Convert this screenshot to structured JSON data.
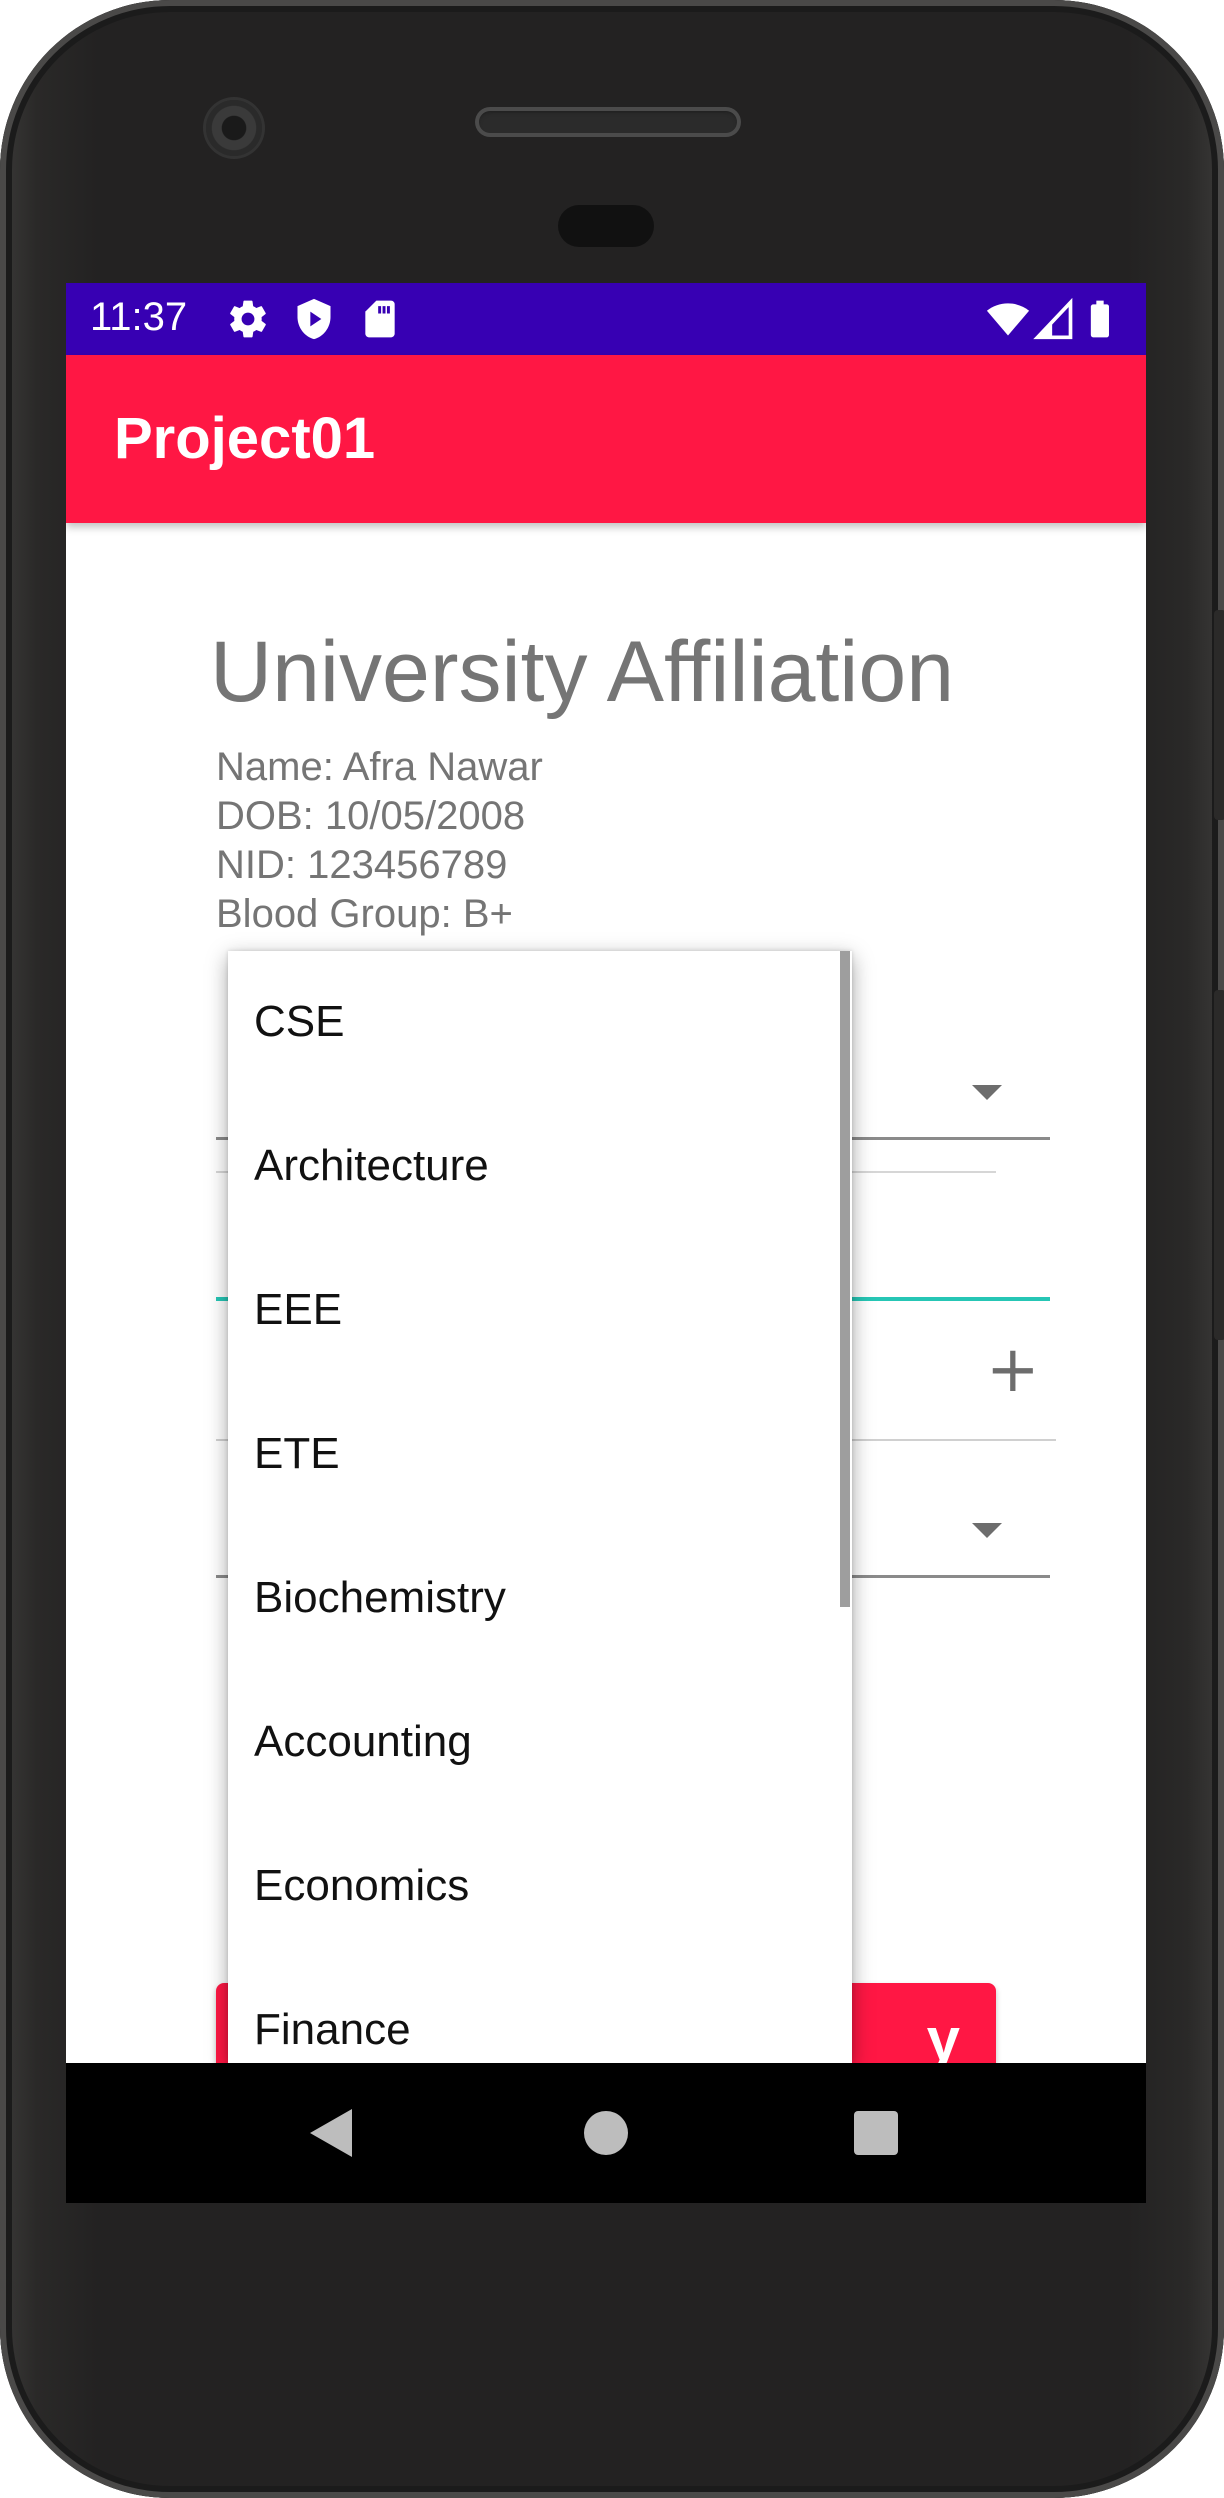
{
  "status_bar": {
    "time": "11:37",
    "left_icons": [
      "settings-icon",
      "shield-play-icon",
      "sd-card-icon"
    ],
    "right_icons": [
      "wifi-icon",
      "signal-icon",
      "battery-icon"
    ],
    "background_color": "#3700b3"
  },
  "app_bar": {
    "title": "Project01",
    "background_color": "#ff1744"
  },
  "form": {
    "title": "University Affiliation",
    "info_lines": [
      "Name: Afra Nawar",
      "DOB: 10/05/2008",
      "NID: 123456789",
      "Blood Group: B+"
    ],
    "apply_button_visible_text": "y",
    "accent_color": "#26c6b5"
  },
  "department_dropdown": {
    "options": [
      "CSE",
      "Architecture",
      "EEE",
      "ETE",
      "Biochemistry",
      "Accounting",
      "Economics",
      "Finance"
    ]
  },
  "nav_bar": {
    "buttons": [
      "back-icon",
      "home-icon",
      "recents-icon"
    ]
  }
}
